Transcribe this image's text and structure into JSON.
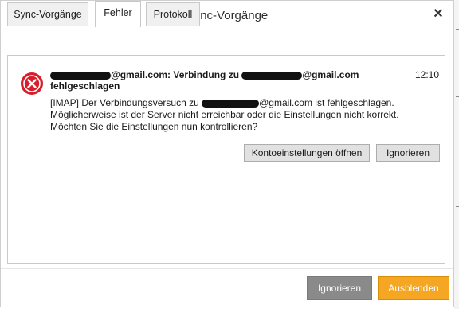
{
  "window": {
    "title": "Sync-Vorgänge",
    "close_glyph": "✕",
    "app_icon": "mailbird-icon",
    "accent_color": "#f5a623"
  },
  "tabs": [
    {
      "label": "Sync-Vorgänge",
      "active": false
    },
    {
      "label": "Fehler",
      "active": true
    },
    {
      "label": "Protokoll",
      "active": false
    }
  ],
  "error": {
    "icon": "error-x-icon",
    "headline_part1": "@gmail.com: Verbindung zu ",
    "headline_part2": "@gmail.com",
    "headline_part3": "fehlgeschlagen",
    "time": "12:10",
    "message_line1_a": "[IMAP] Der Verbindungsversuch zu ",
    "message_line1_b": "@gmail.com ist fehlgeschlagen.",
    "message_line2": "Möglicherweise ist der Server nicht erreichbar oder die Einstellungen nicht korrekt.",
    "message_line3": "Möchten Sie die Einstellungen nun kontrollieren?"
  },
  "actions": {
    "open_settings": "Kontoeinstellungen öffnen",
    "ignore": "Ignorieren"
  },
  "footer": {
    "ignore": "Ignorieren",
    "hide": "Ausblenden"
  }
}
